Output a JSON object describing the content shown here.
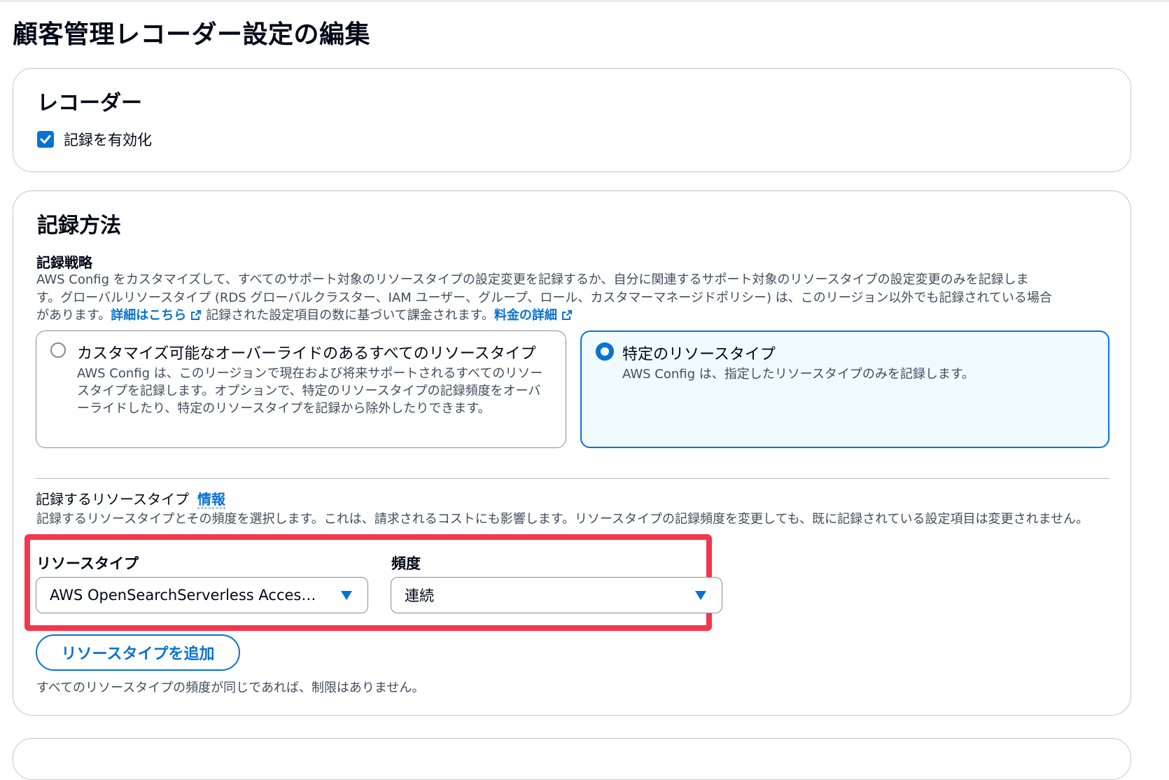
{
  "page": {
    "title": "顧客管理レコーダー設定の編集"
  },
  "recorder": {
    "heading": "レコーダー",
    "checkbox_label": "記録を有効化",
    "checked": true
  },
  "method": {
    "heading": "記録方法",
    "strategy": {
      "label": "記録戦略",
      "desc_line1": "AWS Config をカスタマイズして、すべてのサポート対象のリソースタイプの設定変更を記録するか、自分に関連するサポート対象のリソースタイプの設定変更のみを記録しま",
      "desc_line2": "す。グローバルリソースタイプ (RDS グローバルクラスター、IAM ユーザー、グループ、ロール、カスタマーマネージドポリシー) は、このリージョン以外でも記録されている場合",
      "desc_line3_prefix": "があります。",
      "learn_more_link": "詳細はこちら",
      "desc_line3_middle": "記録された設定項目の数に基づいて課金されます。",
      "pricing_link": "料金の詳細"
    },
    "options": [
      {
        "title": "カスタマイズ可能なオーバーライドのあるすべてのリソースタイプ",
        "description": "AWS Config は、このリージョンで現在および将来サポートされるすべてのリソースタイプを記録します。オプションで、特定のリソースタイプの記録頻度をオーバーライドしたり、特定のリソースタイプを記録から除外したりできます。",
        "selected": false
      },
      {
        "title": "特定のリソースタイプ",
        "description": "AWS Config は、指定したリソースタイプのみを記録します。",
        "selected": true
      }
    ],
    "resource_types": {
      "label": "記録するリソースタイプ",
      "info_link": "情報",
      "description": "記録するリソースタイプとその頻度を選択します。これは、請求されるコストにも影響します。リソースタイプの記録頻度を変更しても、既に記録されている設定項目は変更されません。",
      "columns": {
        "type_label": "リソースタイプ",
        "frequency_label": "頻度"
      },
      "row": {
        "type_value": "AWS OpenSearchServerless AccessPolicy",
        "frequency_value": "連続"
      },
      "add_button": "リソースタイプを追加",
      "hint": "すべてのリソースタイプの頻度が同じであれば、制限はありません。"
    }
  },
  "colors": {
    "accent": "#0972d3",
    "highlight": "#f4364c",
    "selected_tile_bg": "#f0fbff",
    "text_secondary": "#414d5c"
  }
}
